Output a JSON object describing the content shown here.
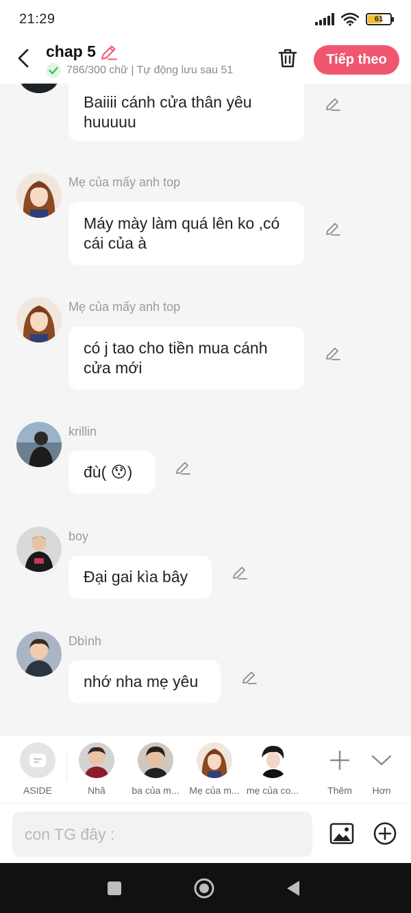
{
  "status_bar": {
    "time": "21:29",
    "battery": "61",
    "battery_level_percent": 61
  },
  "header": {
    "title": "chap 5",
    "subtitle": "786/300 chữ | Tự động lưu sau 51",
    "next_label": "Tiếp theo"
  },
  "messages": [
    {
      "sender": "",
      "text": "Baiiii cánh cửa thân yêu huuuuu"
    },
    {
      "sender": "Mẹ của mấy anh top",
      "text": "Máy mày làm quá lên ko ,có cái của à"
    },
    {
      "sender": "Mẹ của mấy anh top",
      "text": "có j tao cho tiền mua cánh cửa mới"
    },
    {
      "sender": "krillin",
      "text": "đù( 😯)"
    },
    {
      "sender": "boy",
      "text": "Đại gai kìa bây"
    },
    {
      "sender": "Dbình",
      "text": "nhớ nha mẹ yêu"
    }
  ],
  "characters": [
    {
      "label": "ASIDE"
    },
    {
      "label": "Nhã"
    },
    {
      "label": "ba của m..."
    },
    {
      "label": "Mẹ của m..."
    },
    {
      "label": "mẹ của co..."
    }
  ],
  "char_actions": {
    "add_label": "Thêm",
    "more_label": "Hơn"
  },
  "input": {
    "placeholder": "con TG đây :"
  },
  "colors": {
    "accent": "#f0566f",
    "check_green": "#3cc060",
    "background": "#f5f5f5"
  }
}
